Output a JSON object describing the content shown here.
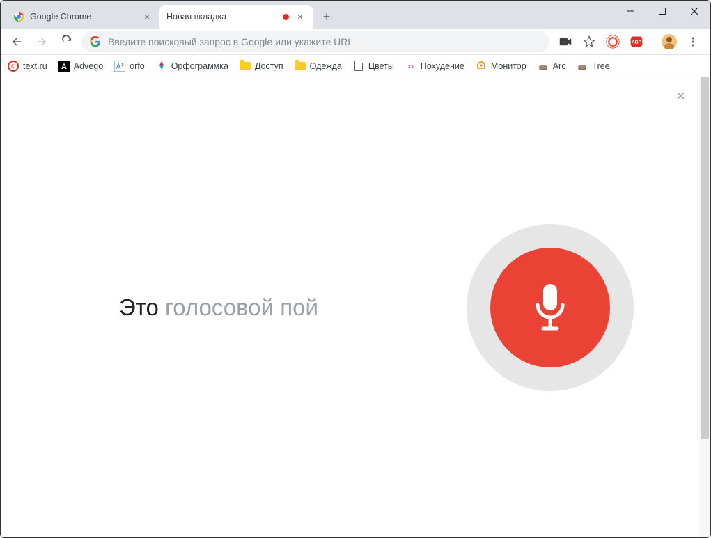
{
  "window": {
    "controls": {
      "min": "—",
      "max": "☐",
      "close": "✕"
    }
  },
  "tabs": [
    {
      "title": "Google Chrome",
      "active": false,
      "recording": false
    },
    {
      "title": "Новая вкладка",
      "active": true,
      "recording": true
    }
  ],
  "omnibox": {
    "placeholder": "Введите поисковый запрос в Google или укажите URL"
  },
  "bookmarks": [
    {
      "label": "text.ru",
      "icon": "textru"
    },
    {
      "label": "Advego",
      "icon": "advego"
    },
    {
      "label": "orfo",
      "icon": "orfo"
    },
    {
      "label": "Орфограммка",
      "icon": "orfogrammka"
    },
    {
      "label": "Доступ",
      "icon": "folder"
    },
    {
      "label": "Одежда",
      "icon": "folder"
    },
    {
      "label": "Цветы",
      "icon": "page"
    },
    {
      "label": "Похудение",
      "icon": "pohud"
    },
    {
      "label": "Монитор",
      "icon": "monitor"
    },
    {
      "label": "Arc",
      "icon": "arc"
    },
    {
      "label": "Tree",
      "icon": "tree"
    }
  ],
  "voice": {
    "text_dark": "Это",
    "text_light": " голосовой пой"
  },
  "colors": {
    "mic_red": "#ea4335",
    "mic_ring": "#e6e6e6"
  }
}
